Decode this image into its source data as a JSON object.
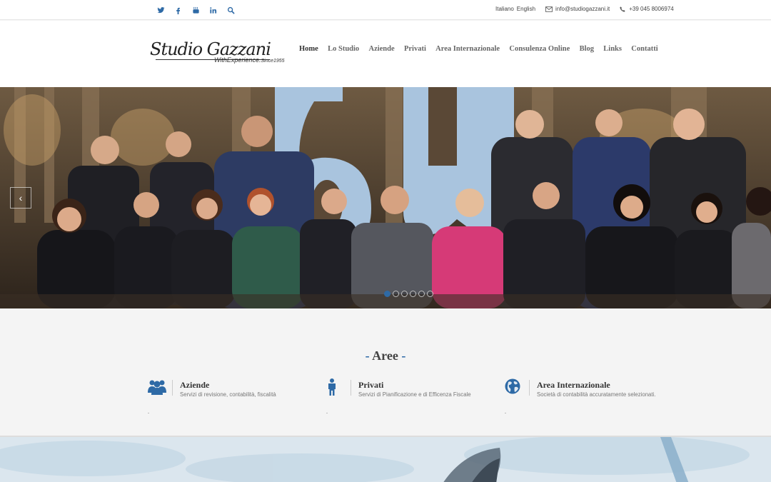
{
  "topbar": {
    "social": [
      "twitter-icon",
      "facebook-icon",
      "youtube-icon",
      "linkedin-icon",
      "search-icon"
    ],
    "lang_it": "Italiano",
    "lang_en": "English",
    "email": "info@studiogazzani.it",
    "phone": "+39 045 8006974"
  },
  "logo": {
    "name": "Studio Gazzani",
    "tagline": "WithExperience",
    "since": "Since1955"
  },
  "nav": {
    "items": [
      "Home",
      "Lo Studio",
      "Aziende",
      "Privati",
      "Area Internazionale",
      "Consulenza Online",
      "Blog",
      "Links",
      "Contatti"
    ],
    "active": "Home"
  },
  "slider": {
    "prev": "‹",
    "dots": 6,
    "active_dot": 0
  },
  "aree": {
    "title": "Aree",
    "dash": "-",
    "items": [
      {
        "title": "Aziende",
        "desc": "Servizi di revisione, contabilità, fiscalità",
        "icon": "group-icon"
      },
      {
        "title": "Privati",
        "desc": "Servizi di Pianificazione e di Efficenza Fiscale",
        "icon": "person-icon"
      },
      {
        "title": "Area Internazionale",
        "desc": "Società di contabilità accuratamente selezionati.",
        "icon": "globe-icon"
      }
    ]
  },
  "colors": {
    "accent": "#2e6aa6",
    "nav_text": "#666666",
    "background": "#f4f4f4"
  }
}
